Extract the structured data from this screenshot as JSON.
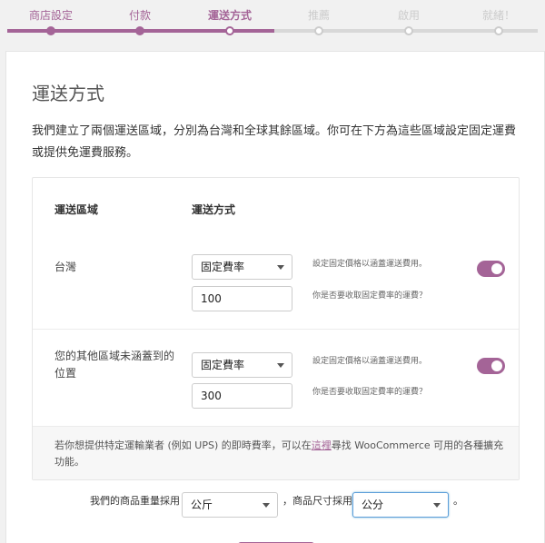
{
  "steps": [
    {
      "label": "商店設定",
      "state": "done"
    },
    {
      "label": "付款",
      "state": "done"
    },
    {
      "label": "運送方式",
      "state": "active"
    },
    {
      "label": "推薦",
      "state": "todo"
    },
    {
      "label": "啟用",
      "state": "todo"
    },
    {
      "label": "就緒！",
      "state": "todo"
    }
  ],
  "colors": {
    "accent": "#a46497",
    "inactive": "#cccccc"
  },
  "page": {
    "title": "運送方式",
    "intro": "我們建立了兩個運送區域，分別為台灣和全球其餘區域。你可在下方為這些區域設定固定運費或提供免運費服務。"
  },
  "table": {
    "col_zone": "運送區域",
    "col_method": "運送方式",
    "zones": [
      {
        "name": "台灣",
        "method": "固定費率",
        "cost": "100",
        "hint_cost": "設定固定價格以涵蓋運送費用。",
        "hint_toggle": "你是否要收取固定費率的運費？",
        "enabled": true
      },
      {
        "name": "您的其他區域未涵蓋到的位置",
        "method": "固定費率",
        "cost": "300",
        "hint_cost": "設定固定價格以涵蓋運送費用。",
        "hint_toggle": "你是否要收取固定費率的運費？",
        "enabled": true
      }
    ],
    "footer_before": "若你想提供特定運輸業者 (例如 UPS) 的即時費率，可以在",
    "footer_link": "這裡",
    "footer_after": "尋找 WooCommerce 可用的各種擴充功能。"
  },
  "units": {
    "weight_label": "我們的商品重量採用",
    "weight_value": "公斤",
    "dimension_label": "，商品尺寸採用",
    "dimension_value": "公分",
    "end": "。"
  }
}
